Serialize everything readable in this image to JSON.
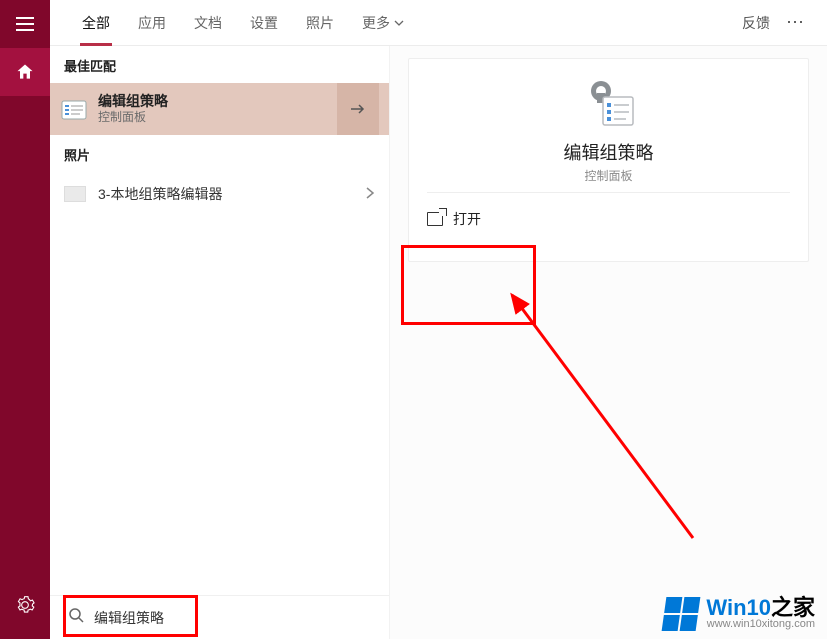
{
  "sidebar": {
    "hamburger": "menu-icon",
    "home": "home-icon",
    "settings": "settings-icon"
  },
  "tabs": {
    "items": [
      "全部",
      "应用",
      "文档",
      "设置",
      "照片",
      "更多"
    ],
    "active_index": 0,
    "feedback": "反馈",
    "more_menu": "⋯"
  },
  "left": {
    "best_header": "最佳匹配",
    "best": {
      "title": "编辑组策略",
      "subtitle": "控制面板"
    },
    "photo_header": "照片",
    "photo_item": "3-本地组策略编辑器"
  },
  "detail": {
    "title": "编辑组策略",
    "subtitle": "控制面板",
    "open_label": "打开"
  },
  "search": {
    "value": "编辑组策略"
  },
  "watermark": {
    "brand_a": "Win10",
    "brand_b": "之家",
    "url": "www.win10xitong.com"
  }
}
